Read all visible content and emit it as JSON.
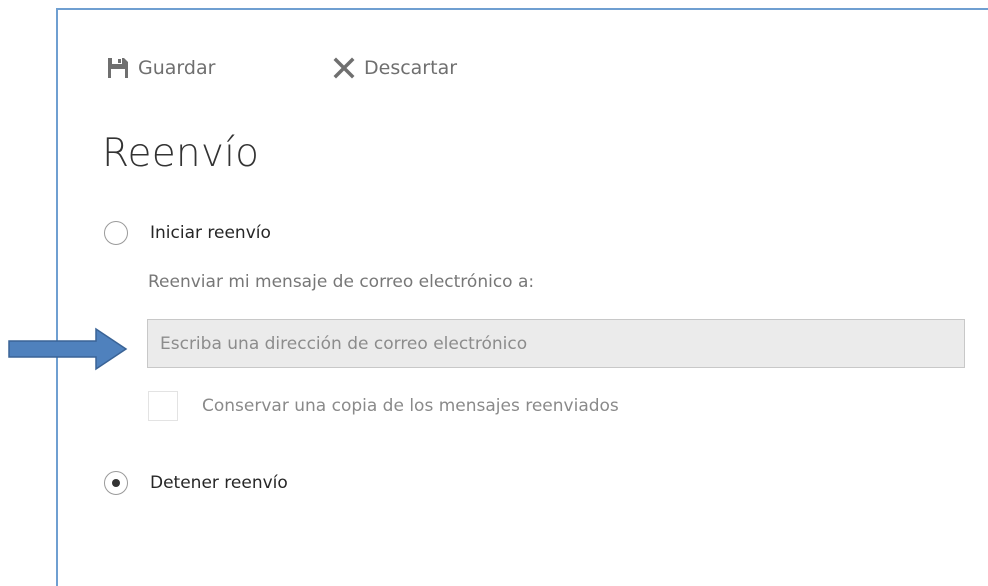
{
  "toolbar": {
    "save_label": "Guardar",
    "discard_label": "Descartar"
  },
  "title": "Reenvío",
  "forwarding": {
    "start_label": "Iniciar reenvío",
    "forward_to_label": "Reenviar mi mensaje de correo electrónico a:",
    "email_placeholder": "Escriba una dirección de correo electrónico",
    "email_value": "",
    "keep_copy_label": "Conservar una copia de los mensajes reenviados",
    "keep_copy_checked": false,
    "stop_label": "Detener reenvío",
    "selected_option": "stop"
  },
  "colors": {
    "panel_border": "#6f9fd1",
    "arrow_fill": "#4f81bd",
    "arrow_stroke": "#3a6396",
    "input_background": "#ebebeb"
  },
  "icons": {
    "save": "save-icon",
    "discard": "close-icon",
    "annotation": "right-arrow-icon"
  }
}
